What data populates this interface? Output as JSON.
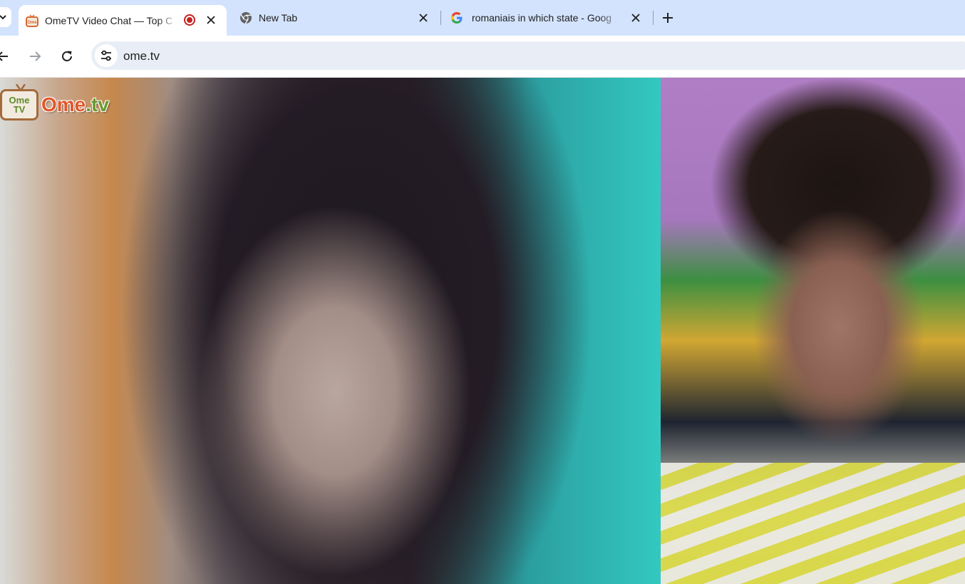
{
  "browser": {
    "tabs": [
      {
        "title": "OmeTV Video Chat — Top C",
        "active": true,
        "recording": true,
        "favicon": "ometv-favicon"
      },
      {
        "title": "New Tab",
        "active": false,
        "favicon": "chrome-icon"
      },
      {
        "title": "romaniais in which state - Goog",
        "active": false,
        "favicon": "google-g-icon"
      }
    ],
    "address_bar": {
      "url": "ome.tv"
    }
  },
  "page": {
    "logo": {
      "tv_line1": "Ome",
      "tv_line2": "TV",
      "text_main": "Ome",
      "text_suffix": ".tv"
    },
    "videos": [
      {
        "role": "remote-stranger-video"
      },
      {
        "role": "local-self-video"
      }
    ]
  },
  "colors": {
    "tabstrip": "#d3e3fd",
    "omnibox": "#e9eef6",
    "recording": "#c5221f",
    "logo_orange": "#e2572a",
    "logo_green": "#6b9a30"
  }
}
